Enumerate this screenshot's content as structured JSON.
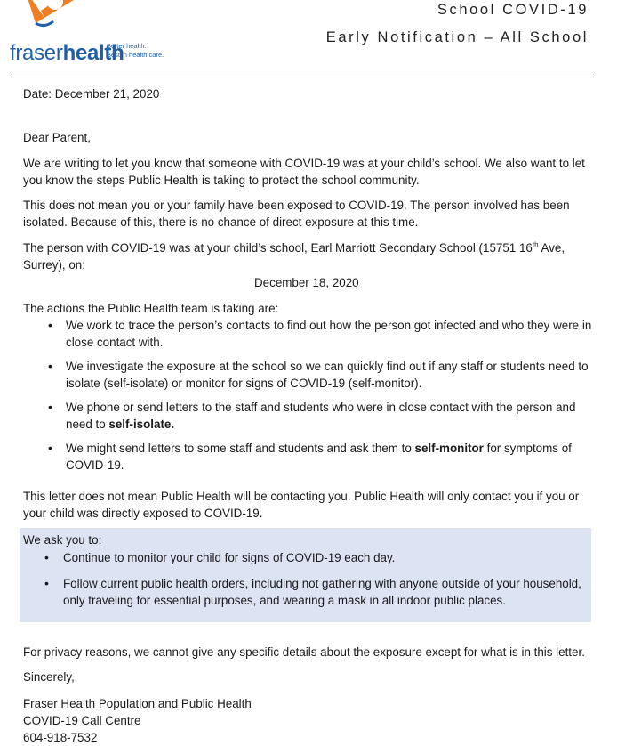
{
  "header": {
    "brand_light": "fraser",
    "brand_bold": "health",
    "tagline_1": "Better health.",
    "tagline_2": "Best in health care.",
    "title_1": "School COVID-19",
    "title_2": "Early Notification – All School",
    "colors": {
      "brand_blue": "#1f5fa8",
      "logo_orange": "#ef7d22"
    }
  },
  "letter": {
    "date": "Date: December 21, 2020",
    "salutation": "Dear Parent,",
    "intro": "We are writing to let you know that someone with COVID-19 was at your child’s school. We also want to let you know the steps Public Health is taking to protect the school community.",
    "not_exposed": "This does not mean you or your family have been exposed to COVID-19. The person involved has been isolated. Because of this, there is no chance of direct exposure at this time.",
    "location_prefix": "The person with COVID-19 was at your child’s school, Earl Marriott Secondary School (15751 16",
    "location_sup": "th",
    "location_suffix": " Ave, Surrey), on:",
    "exposure_date": "December 18, 2020",
    "actions_heading": "The actions the Public Health team is taking are:",
    "actions": [
      {
        "text": "We work to trace the person’s contacts to find out how the person got infected and who they were in close contact with."
      },
      {
        "text": "We investigate the exposure at the school so we can quickly find out if any staff or students need to isolate (self-isolate) or monitor for signs of COVID-19 (self-monitor)."
      },
      {
        "pre": "We phone or send letters to the staff and students who were in close contact with the person and need to ",
        "bold": "self-isolate.",
        "post": ""
      },
      {
        "pre": "We might send letters to some staff and students and ask them to ",
        "bold": "self-monitor",
        "post": " for symptoms of COVID-19."
      }
    ],
    "contact_note": "This letter does not mean Public Health will be contacting you. Public Health will only contact you if you or your child was directly exposed to COVID-19.",
    "ask_heading": "We ask you to:",
    "asks": [
      "Continue to monitor your child for signs of COVID-19 each day.",
      "Follow current public health orders, including not gathering with anyone outside of your household, only traveling for essential purposes, and wearing a mask in all indoor public places."
    ],
    "privacy": "For privacy reasons, we cannot give any specific details about the exposure except for what is in this letter.",
    "closing": "Sincerely,",
    "signature_1": "Fraser Health Population and Public Health",
    "signature_2": "COVID-19 Call Centre",
    "signature_3": "604-918-7532"
  }
}
